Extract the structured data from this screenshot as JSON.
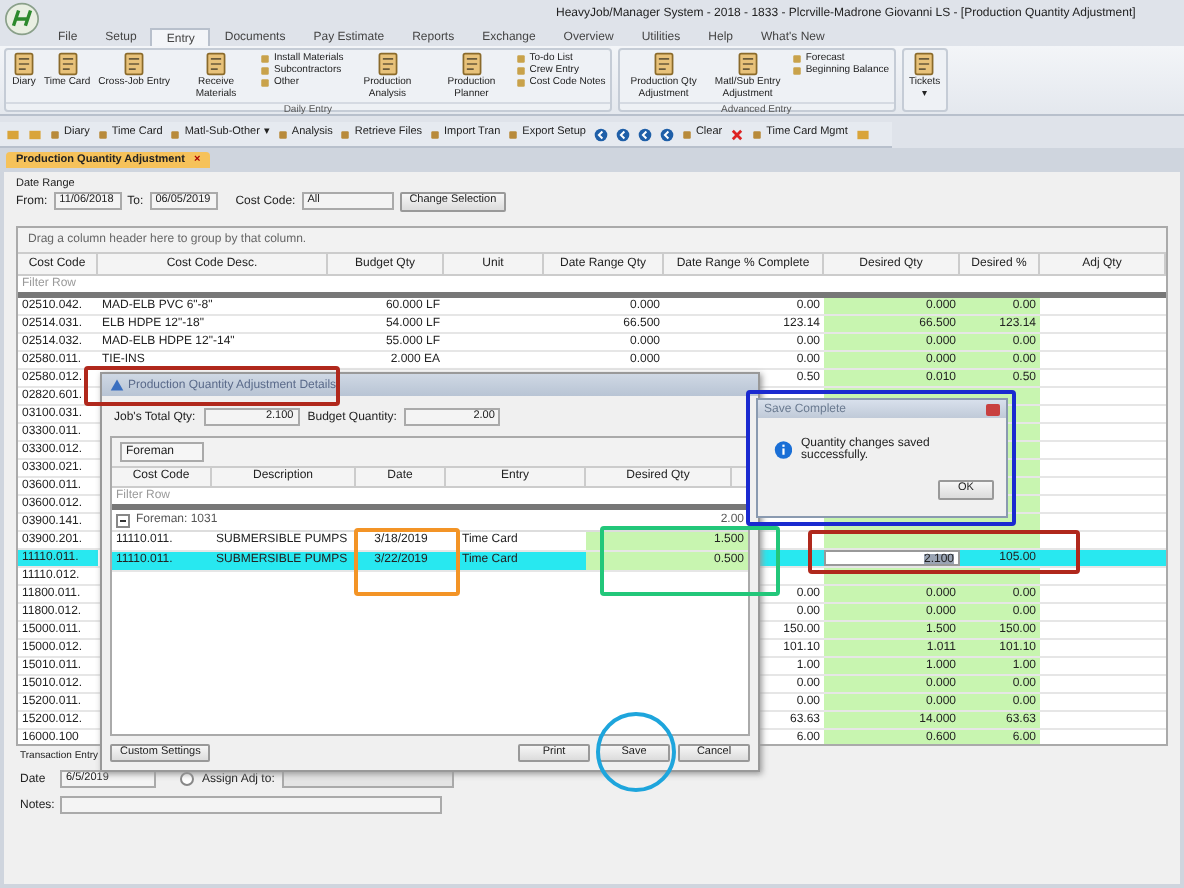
{
  "window": {
    "title": "HeavyJob/Manager System - 2018 - 1833 - Plcrville-Madrone Giovanni LS - [Production Quantity Adjustment]"
  },
  "menu_tabs": [
    {
      "label": "File",
      "selected": false
    },
    {
      "label": "Setup",
      "selected": false
    },
    {
      "label": "Entry",
      "selected": true
    },
    {
      "label": "Documents",
      "selected": false
    },
    {
      "label": "Pay Estimate",
      "selected": false
    },
    {
      "label": "Reports",
      "selected": false
    },
    {
      "label": "Exchange",
      "selected": false
    },
    {
      "label": "Overview",
      "selected": false
    },
    {
      "label": "Utilities",
      "selected": false
    },
    {
      "label": "Help",
      "selected": false
    },
    {
      "label": "What's New",
      "selected": false
    }
  ],
  "ribbon_groups": [
    {
      "label": "Daily Entry",
      "items": [
        {
          "kind": "large",
          "label": "Diary"
        },
        {
          "kind": "large",
          "label": "Time Card"
        },
        {
          "kind": "large",
          "label": "Cross-Job Entry"
        },
        {
          "kind": "large",
          "label": "Receive Materials"
        },
        {
          "kind": "small",
          "items": [
            "Install Materials",
            "Subcontractors",
            "Other"
          ]
        },
        {
          "kind": "large",
          "label": "Production Analysis"
        },
        {
          "kind": "large",
          "label": "Production Planner"
        },
        {
          "kind": "small",
          "items": [
            "To-do List",
            "Crew Entry",
            "Cost Code Notes"
          ]
        }
      ]
    },
    {
      "label": "Advanced Entry",
      "items": [
        {
          "kind": "large",
          "label": "Production Qty Adjustment"
        },
        {
          "kind": "large",
          "label": "Matl/Sub Entry Adjustment"
        },
        {
          "kind": "small",
          "items": [
            "Forecast",
            "Beginning Balance"
          ]
        }
      ]
    },
    {
      "items": [
        {
          "kind": "large",
          "label": "Tickets",
          "caret": "▾"
        }
      ]
    }
  ],
  "toolbar": [
    {
      "kind": "icon"
    },
    {
      "kind": "icon"
    },
    {
      "kind": "button",
      "label": "Diary"
    },
    {
      "kind": "button",
      "label": "Time Card"
    },
    {
      "kind": "button",
      "label": "Matl-Sub-Other",
      "caret": "▾"
    },
    {
      "kind": "button",
      "label": "Analysis"
    },
    {
      "kind": "button",
      "label": "Retrieve Files"
    },
    {
      "kind": "button",
      "label": "Import Tran"
    },
    {
      "kind": "button",
      "label": "Export Setup"
    },
    {
      "kind": "nav"
    },
    {
      "kind": "nav"
    },
    {
      "kind": "nav"
    },
    {
      "kind": "nav"
    },
    {
      "kind": "button",
      "label": "Clear"
    },
    {
      "kind": "delete"
    },
    {
      "kind": "button",
      "label": "Time Card Mgmt"
    },
    {
      "kind": "icon"
    }
  ],
  "document_tab": {
    "label": "Production Quantity Adjustment",
    "close": "×"
  },
  "date_range": {
    "title": "Date Range",
    "from_label": "From:",
    "from": "11/06/2018",
    "to_label": "To:",
    "to": "06/05/2019",
    "cost_code_label": "Cost Code:",
    "cost_code": "All",
    "button": "Change Selection"
  },
  "grid": {
    "group_hint": "Drag a column header here to group by that column.",
    "filter_label": "Filter Row",
    "columns": [
      "Cost Code",
      "Cost Code Desc.",
      "Budget Qty",
      "Unit",
      "Date Range Qty",
      "Date Range % Complete",
      "Desired Qty",
      "Desired %",
      "Adj Qty"
    ],
    "rows": [
      {
        "code": "02510.042.",
        "desc": "MAD-ELB PVC 6\"-8\"",
        "budget": "60.000 LF",
        "range_qty": "0.000",
        "range_pct": "0.00",
        "desired_qty": "0.000",
        "desired_pct": "0.00",
        "selected": false
      },
      {
        "code": "02514.031.",
        "desc": "ELB HDPE 12\"-18\"",
        "budget": "54.000 LF",
        "range_qty": "66.500",
        "range_pct": "123.14",
        "desired_qty": "66.500",
        "desired_pct": "123.14",
        "selected": false
      },
      {
        "code": "02514.032.",
        "desc": "MAD-ELB HDPE 12\"-14\"",
        "budget": "55.000 LF",
        "range_qty": "0.000",
        "range_pct": "0.00",
        "desired_qty": "0.000",
        "desired_pct": "0.00",
        "selected": false
      },
      {
        "code": "02580.011.",
        "desc": "TIE-INS",
        "budget": "2.000 EA",
        "range_qty": "0.000",
        "range_pct": "0.00",
        "desired_qty": "0.000",
        "desired_pct": "0.00",
        "selected": false
      },
      {
        "code": "02580.012.",
        "range_pct": "0.50",
        "desired_qty": "0.010",
        "desired_pct": "0.50",
        "selected": false
      },
      {
        "code": "02820.601.",
        "selected": false
      },
      {
        "code": "03100.031.",
        "selected": false
      },
      {
        "code": "03300.011.",
        "selected": false
      },
      {
        "code": "03300.012.",
        "selected": false
      },
      {
        "code": "03300.021.",
        "selected": false
      },
      {
        "code": "03600.011.",
        "selected": false
      },
      {
        "code": "03600.012.",
        "selected": false
      },
      {
        "code": "03900.141.",
        "selected": false
      },
      {
        "code": "03900.201.",
        "selected": false
      },
      {
        "code": "11110.011.",
        "desired_qty": "2.100",
        "desired_pct": "105.00",
        "selected": true,
        "editing": true
      },
      {
        "code": "11110.012.",
        "selected": false
      },
      {
        "code": "11800.011.",
        "range_pct": "0.00",
        "desired_qty": "0.000",
        "desired_pct": "0.00",
        "selected": false
      },
      {
        "code": "11800.012.",
        "range_pct": "0.00",
        "desired_qty": "0.000",
        "desired_pct": "0.00",
        "selected": false
      },
      {
        "code": "15000.011.",
        "range_pct": "150.00",
        "desired_qty": "1.500",
        "desired_pct": "150.00",
        "selected": false
      },
      {
        "code": "15000.012.",
        "range_pct": "101.10",
        "desired_qty": "1.011",
        "desired_pct": "101.10",
        "selected": false
      },
      {
        "code": "15010.011.",
        "range_pct": "1.00",
        "desired_qty": "1.000",
        "desired_pct": "1.00",
        "selected": false
      },
      {
        "code": "15010.012.",
        "range_pct": "0.00",
        "desired_qty": "0.000",
        "desired_pct": "0.00",
        "selected": false
      },
      {
        "code": "15200.011.",
        "range_pct": "0.00",
        "desired_qty": "0.000",
        "desired_pct": "0.00",
        "selected": false
      },
      {
        "code": "15200.012.",
        "range_pct": "63.63",
        "desired_qty": "14.000",
        "desired_pct": "63.63",
        "selected": false
      },
      {
        "code": "16000.100",
        "range_pct": "6.00",
        "desired_qty": "0.600",
        "desired_pct": "6.00",
        "selected": false
      }
    ]
  },
  "transaction": {
    "title": "Transaction Entry",
    "date_label": "Date",
    "date": "6/5/2019",
    "assign_label": "Assign Adj to:",
    "assign_selected": false,
    "notes_label": "Notes:"
  },
  "details_dialog": {
    "title": "Production Quantity Adjustment Details",
    "total_label": "Job's Total Qty:",
    "total": "2.100",
    "budget_label": "Budget Quantity:",
    "budget": "2.00",
    "combo": "Foreman",
    "columns": [
      "Cost Code",
      "Description",
      "Date",
      "Entry",
      "Desired Qty"
    ],
    "filter_label": "Filter Row",
    "group": {
      "label": "Foreman: 1031",
      "total": "2.00",
      "expanded": true
    },
    "rows": [
      {
        "code": "11110.011.",
        "desc": "SUBMERSIBLE PUMPS",
        "date": "3/18/2019",
        "entry": "Time Card",
        "qty": "1.500",
        "selected": false
      },
      {
        "code": "11110.011.",
        "desc": "SUBMERSIBLE PUMPS",
        "date": "3/22/2019",
        "entry": "Time Card",
        "qty": "0.500",
        "selected": true
      }
    ],
    "buttons": [
      "Custom Settings",
      "Print",
      "Save",
      "Cancel"
    ]
  },
  "message_box": {
    "title": "Save Complete",
    "message": "Quantity changes saved successfully.",
    "button": "OK"
  },
  "annotations": [
    {
      "kind": "rect",
      "color": "#b0281c"
    },
    {
      "kind": "rect",
      "color": "#1a2ad0"
    },
    {
      "kind": "rect",
      "color": "#22c77a"
    },
    {
      "kind": "rect",
      "color": "#f39426"
    },
    {
      "kind": "rect",
      "color": "#b0281c"
    },
    {
      "kind": "circle",
      "color": "#1ea5dc"
    }
  ]
}
